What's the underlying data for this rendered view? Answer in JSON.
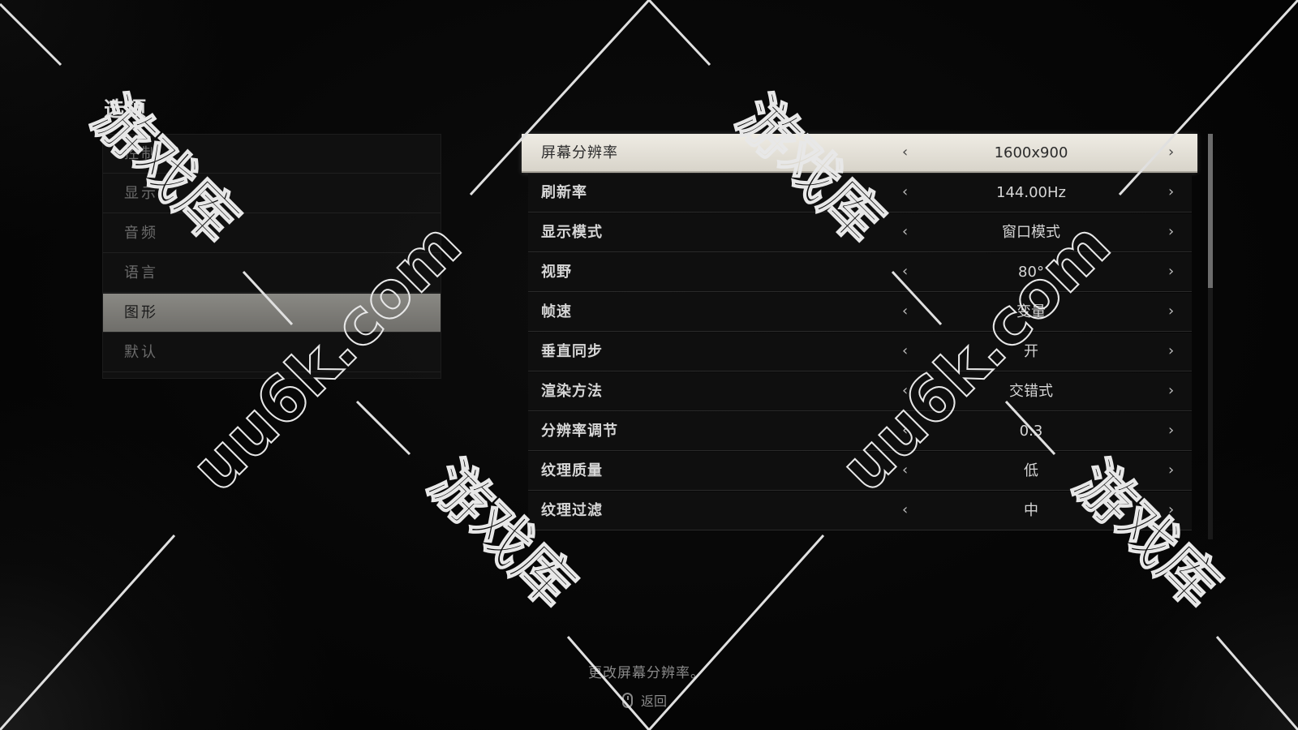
{
  "menu": {
    "title": "选项",
    "items": [
      {
        "label": "控制"
      },
      {
        "label": "显示"
      },
      {
        "label": "音频"
      },
      {
        "label": "语言"
      },
      {
        "label": "图形",
        "selected": true
      },
      {
        "label": "默认"
      }
    ]
  },
  "settings": {
    "rows": [
      {
        "label": "屏幕分辨率",
        "value": "1600x900",
        "selected": true
      },
      {
        "label": "刷新率",
        "value": "144.00Hz"
      },
      {
        "label": "显示模式",
        "value": "窗口模式"
      },
      {
        "label": "视野",
        "value": "80°"
      },
      {
        "label": "帧速",
        "value": "变量"
      },
      {
        "label": "垂直同步",
        "value": "开"
      },
      {
        "label": "渲染方法",
        "value": "交错式"
      },
      {
        "label": "分辨率调节",
        "value": "0.3"
      },
      {
        "label": "纹理质量",
        "value": "低"
      },
      {
        "label": "纹理过滤",
        "value": "中"
      }
    ],
    "arrow_left": "‹",
    "arrow_right": "›"
  },
  "footer": {
    "hint": "更改屏幕分辨率。",
    "back_label": "返回",
    "back_icon": "mouse-icon"
  },
  "watermark": {
    "site": "uu6k.com",
    "brand": "游戏库"
  },
  "colors": {
    "background": "#050505",
    "selected_row": "#e4e1d8",
    "selected_menu": "#7f7e7a",
    "text": "#d6d6d6",
    "muted_text": "#6d6d6d"
  }
}
